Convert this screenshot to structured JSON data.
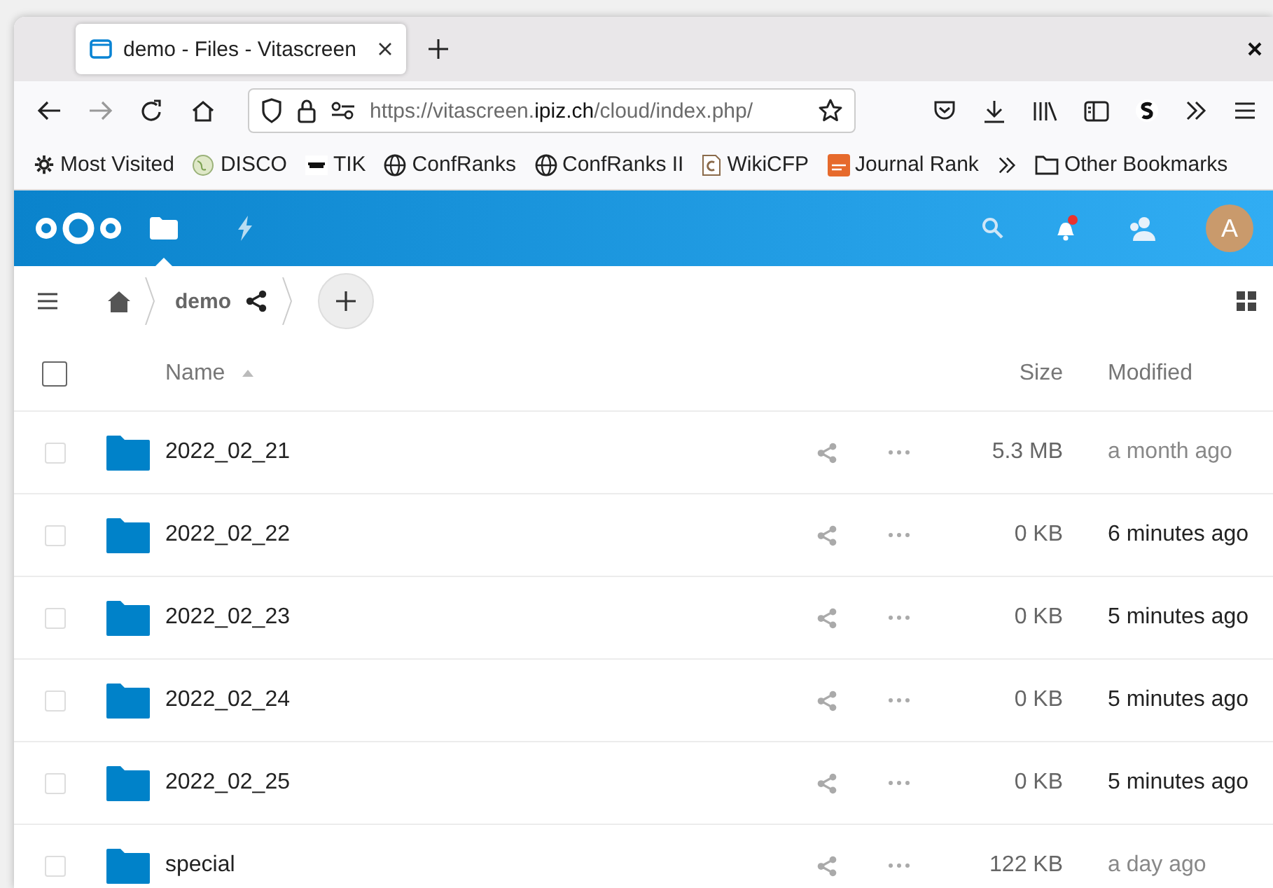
{
  "browser": {
    "tab": {
      "title": "demo - Files - Vitascreen",
      "selected": true
    },
    "url": {
      "prefix": "https://vitascreen.",
      "domain": "ipiz.ch",
      "path": "/cloud/index.php/"
    },
    "bookmarks": [
      "Most Visited",
      "DISCO",
      "TIK",
      "ConfRanks",
      "ConfRanks II",
      "WikiCFP",
      "Journal Rank"
    ],
    "other_bookmarks": "Other Bookmarks"
  },
  "header": {
    "apps": [
      {
        "kind": "files",
        "selected": true
      },
      {
        "kind": "activity",
        "selected": false
      }
    ],
    "notifications_unread": true,
    "avatar_letter": "A"
  },
  "breadcrumb": {
    "folder": "demo"
  },
  "table": {
    "all_checked": false,
    "columns": {
      "name": "Name",
      "size": "Size",
      "modified": "Modified"
    },
    "rows": [
      {
        "name": "2022_02_21",
        "size": "5.3 MB",
        "modified": "a month ago",
        "recent": false,
        "checked": false
      },
      {
        "name": "2022_02_22",
        "size": "0 KB",
        "modified": "6 minutes ago",
        "recent": true,
        "checked": false
      },
      {
        "name": "2022_02_23",
        "size": "0 KB",
        "modified": "5 minutes ago",
        "recent": true,
        "checked": false
      },
      {
        "name": "2022_02_24",
        "size": "0 KB",
        "modified": "5 minutes ago",
        "recent": true,
        "checked": false
      },
      {
        "name": "2022_02_25",
        "size": "0 KB",
        "modified": "5 minutes ago",
        "recent": true,
        "checked": false
      },
      {
        "name": "special",
        "size": "122 KB",
        "modified": "a day ago",
        "recent": false,
        "checked": false
      }
    ]
  }
}
